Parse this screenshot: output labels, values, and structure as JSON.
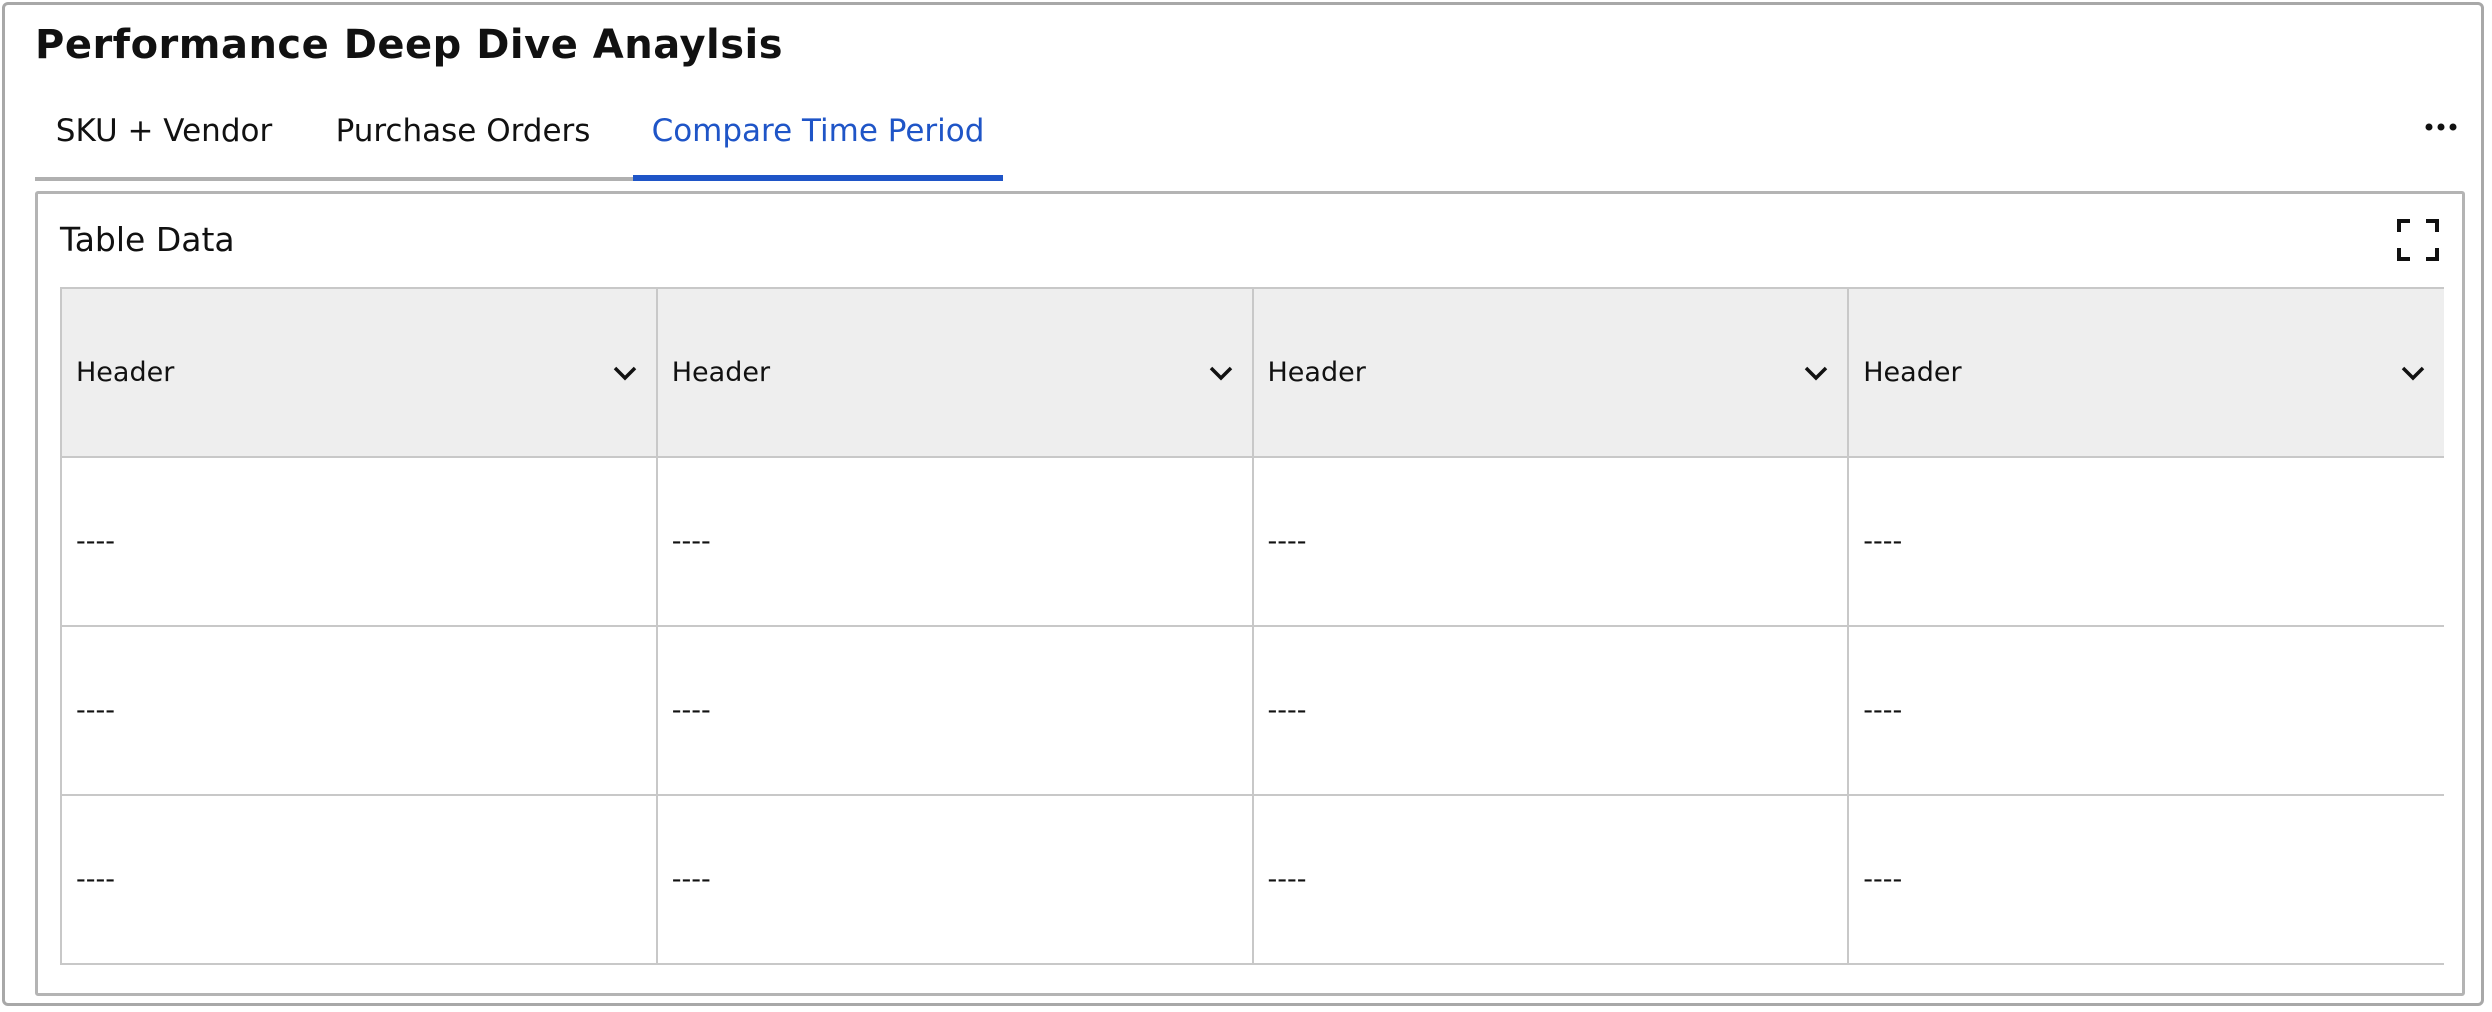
{
  "page": {
    "title": "Performance Deep Dive Anaylsis"
  },
  "tabs": [
    {
      "label": "SKU + Vendor",
      "active": false
    },
    {
      "label": "Purchase Orders",
      "active": false
    },
    {
      "label": "Compare Time Period",
      "active": true
    }
  ],
  "colors": {
    "accent": "#1f55c7",
    "header_bg": "#eeeeee",
    "border": "#c8c8c8"
  },
  "icons": {
    "more": "more-horizontal-icon",
    "expand": "fullscreen-expand-icon",
    "sort": "chevron-down-icon"
  },
  "card": {
    "title": "Table Data"
  },
  "table": {
    "headers": [
      "Header",
      "Header",
      "Header",
      "Header"
    ],
    "rows": [
      [
        "----",
        "----",
        "----",
        "----"
      ],
      [
        "----",
        "----",
        "----",
        "----"
      ],
      [
        "----",
        "----",
        "----",
        "----"
      ]
    ]
  }
}
